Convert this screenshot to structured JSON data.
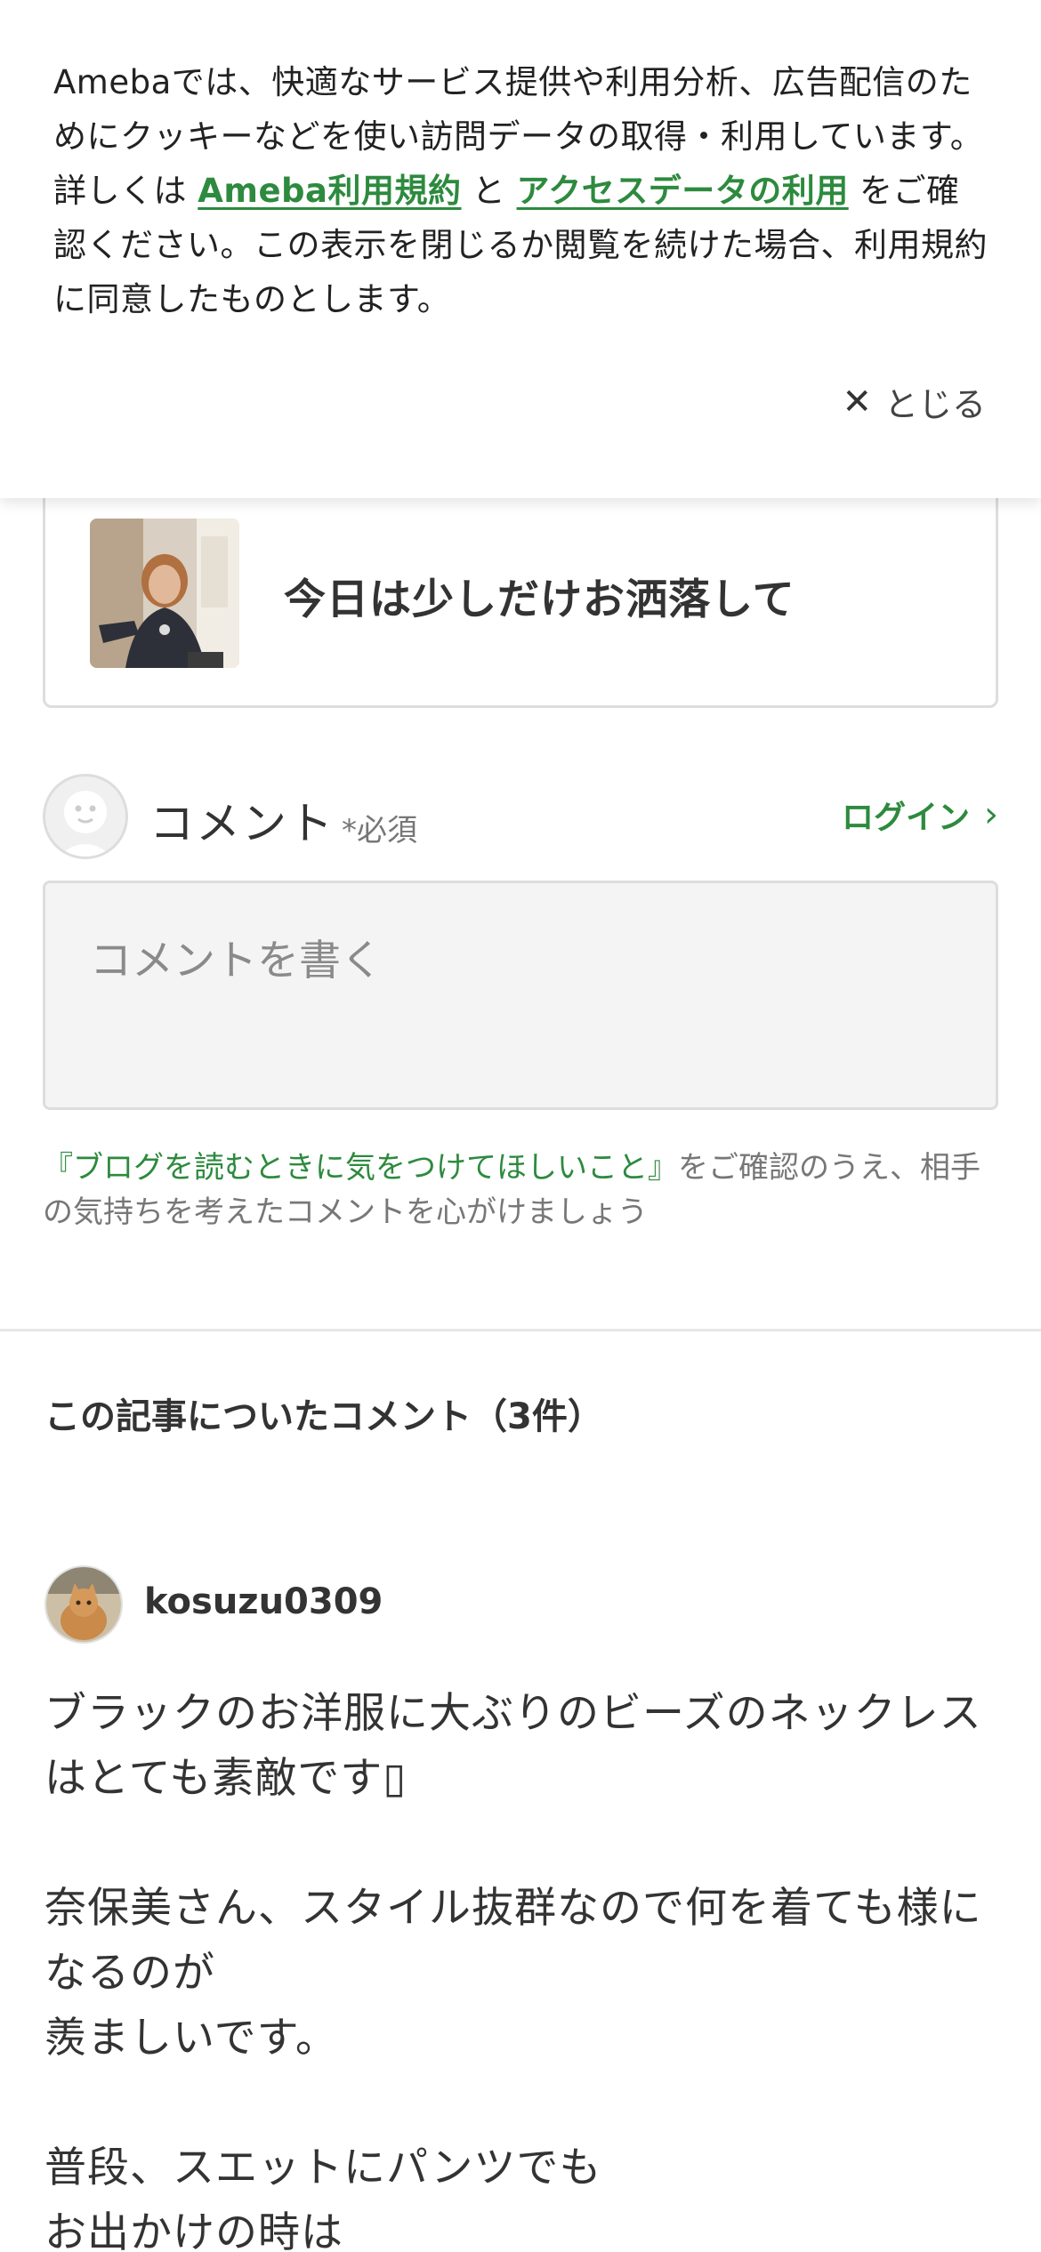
{
  "cookie_banner": {
    "text_before": "Amebaでは、快適なサービス提供や利用分析、広告配信のためにクッキーなどを使い訪問データの取得・利用しています。詳しくは ",
    "link1": "Ameba利用規約",
    "text_mid": " と ",
    "link2": "アクセスデータの利用",
    "text_after": " をご確認ください。この表示を閉じるか閲覧を続けた場合、利用規約に同意したものとします。",
    "close_label": "とじる"
  },
  "article": {
    "title": "今日は少しだけお洒落して"
  },
  "comment_form": {
    "label": "コメント",
    "required": "*必須",
    "login": "ログイン",
    "placeholder": "コメントを書く",
    "notice_link": "『ブログを読むときに気をつけてほしいこと』",
    "notice_text": "をご確認のうえ、相手の気持ちを考えたコメントを心がけましょう"
  },
  "comments": {
    "heading": "この記事についたコメント（3件）",
    "items": [
      {
        "author": "kosuzu0309",
        "paragraphs": [
          "ブラックのお洋服に大ぶりのビーズのネックレスはとても素敵です▯",
          "奈保美さん、スタイル抜群なので何を着ても様になるのが\n羨ましいです。",
          "普段、スエットにパンツでも\nお出かけの時は"
        ]
      }
    ]
  },
  "colors": {
    "accent_green": "#2d8a3e",
    "text": "#333333",
    "muted": "#777777"
  }
}
